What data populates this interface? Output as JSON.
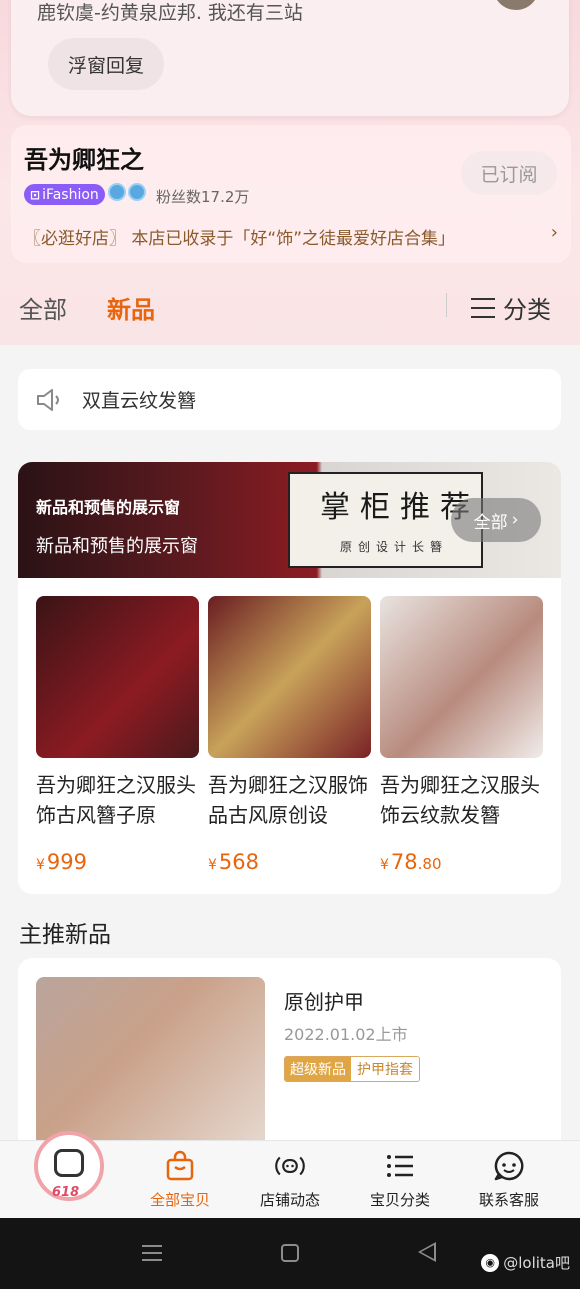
{
  "float_card": {
    "prev_text": "鹿钦虞-约黄泉应邦. 我还有三站",
    "button_label": "浮窗回复"
  },
  "shop": {
    "name": "吾为卿狂之",
    "subscribe_label": "已订阅",
    "badge_label": "iFashion",
    "fans": "粉丝数17.2万",
    "promo": "〖必逛好店〗 本店已收录于「好“饰”之徒最爱好店合集」",
    "promo_arrow": "›"
  },
  "tabs": {
    "all": "全部",
    "new": "新品",
    "category": "分类"
  },
  "notice": {
    "text": "双直云纹发簪"
  },
  "showcase": {
    "banner_title": "新品和预售的展示窗",
    "banner_subtitle": "新品和预售的展示窗",
    "sign_line1": "掌柜推荐",
    "sign_line2": "原创设计长簪",
    "all_label": "全部",
    "products": [
      {
        "title": "吾为卿狂之汉服头饰古风簪子原",
        "price": "999",
        "decimal": ""
      },
      {
        "title": "吾为卿狂之汉服饰品古风原创设",
        "price": "568",
        "decimal": ""
      },
      {
        "title": "吾为卿狂之汉服头饰云纹款发簪",
        "price": "78",
        "decimal": ".80"
      }
    ],
    "currency": "¥"
  },
  "main_push": {
    "section_title": "主推新品",
    "name": "原创护甲",
    "date": "2022.01.02上市",
    "tag1": "超级新品",
    "tag2": "护甲指套"
  },
  "bottom_nav": {
    "logo_text": "618",
    "items": [
      {
        "label": "全部宝贝",
        "icon": "bag-icon",
        "active": true
      },
      {
        "label": "店铺动态",
        "icon": "broadcast-icon",
        "active": false
      },
      {
        "label": "宝贝分类",
        "icon": "list-icon",
        "active": false
      },
      {
        "label": "联系客服",
        "icon": "chat-face-icon",
        "active": false
      }
    ]
  },
  "watermark": {
    "text": "@lolita吧"
  },
  "colors": {
    "accent": "#e8650e",
    "ifashion": "#8b5cf6",
    "promo": "#8a5a2b"
  }
}
